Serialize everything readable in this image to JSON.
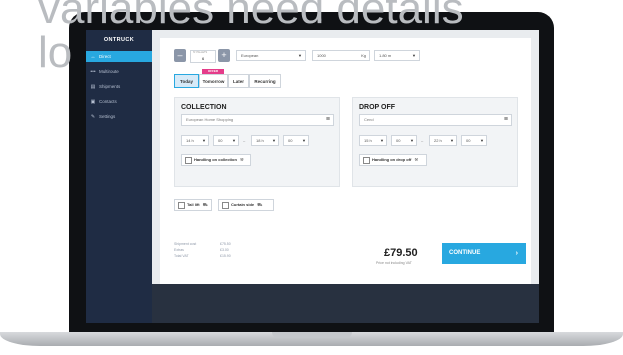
{
  "hero": {
    "line1": "variables need details",
    "line2": "lo"
  },
  "sidebar": {
    "logo": "ONTRUCK",
    "items": [
      {
        "icon": "↔",
        "label": "Direct",
        "active": true
      },
      {
        "icon": "•••",
        "label": "Multiroute",
        "active": false
      },
      {
        "icon": "▤",
        "label": "Shipments",
        "active": false
      },
      {
        "icon": "▣",
        "label": "Contacts",
        "active": false
      },
      {
        "icon": "✎",
        "label": "Settings",
        "active": false
      }
    ]
  },
  "options": {
    "stepper_caption": "Nº PALLETS",
    "stepper_value": "6",
    "stepper_minus": "–",
    "stepper_plus": "+",
    "pallet_type": "European",
    "weight_value": "1000",
    "weight_unit": "Kg",
    "height": "1.80 m"
  },
  "tabs": {
    "today": "Today",
    "tomorrow": "Tomorrow",
    "later": "Later",
    "recurring": "Recurring",
    "offer_badge": "OFFER"
  },
  "collection": {
    "title": "COLLECTION",
    "address": "European Home Shopping",
    "from_hour": "14 h",
    "from_min": "00",
    "to_hour": "18 h",
    "to_min": "00",
    "dash": "–",
    "handling_label": "Handling on collection"
  },
  "dropoff": {
    "title": "DROP OFF",
    "address": "Cend",
    "from_hour": "15 h",
    "from_min": "00",
    "to_hour": "22 h",
    "to_min": "00",
    "dash": "–",
    "handling_label": "Handling on drop off"
  },
  "extras": {
    "tail_lift": "Tail lift",
    "curtain_side": "Curtain side"
  },
  "summary": {
    "rows": [
      {
        "label": "Shipment cost",
        "value": "£75.50"
      },
      {
        "label": "Extras",
        "value": "£3.00"
      },
      {
        "label": "Total VAT",
        "value": "£15.90"
      }
    ],
    "price": "£79.50",
    "price_note": "Price not including VAT",
    "continue_label": "CONTINUE",
    "continue_arrow": "›"
  },
  "colors": {
    "accent": "#28a8e0",
    "sidebar": "#1f2c44",
    "offer": "#e53c8a"
  }
}
